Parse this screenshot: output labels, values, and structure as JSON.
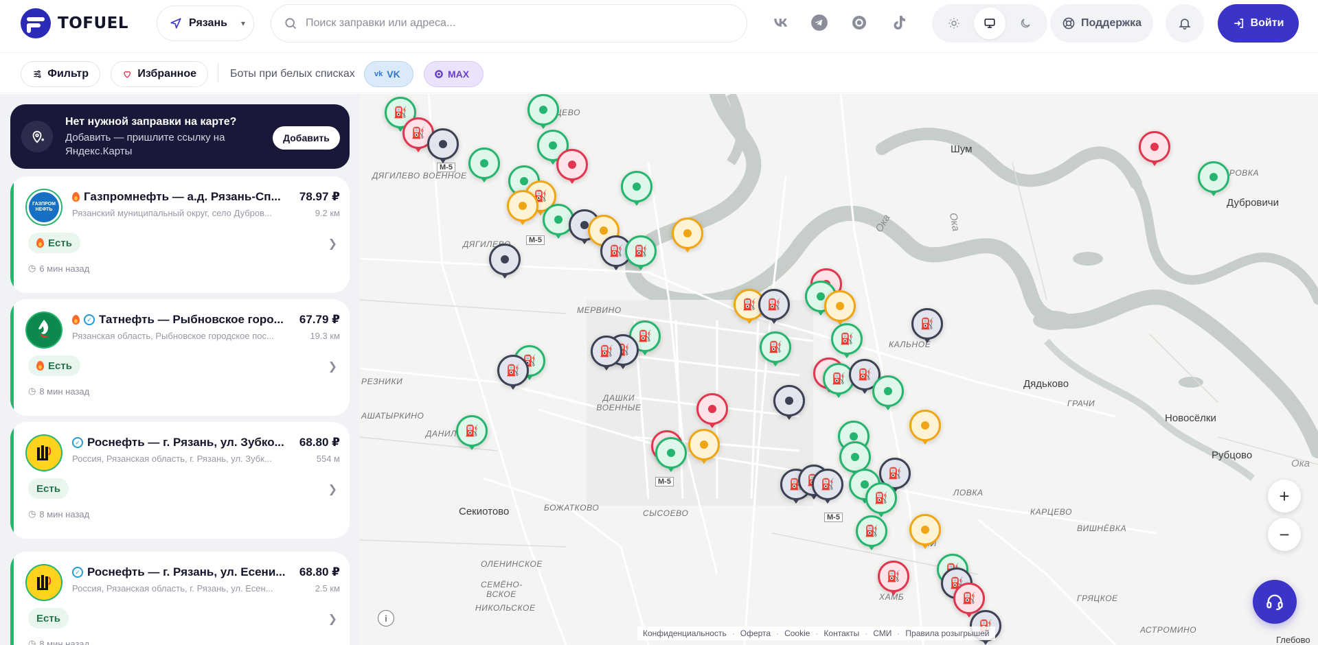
{
  "header": {
    "logo_text": "TOFUEL",
    "city": "Рязань",
    "search_placeholder": "Поиск заправки или адреса...",
    "socials": [
      "vk-icon",
      "telegram-icon",
      "max-icon",
      "tiktok-icon"
    ],
    "theme_options": [
      "light",
      "system",
      "dark"
    ],
    "theme_active": "system",
    "support_label": "Поддержка",
    "login_label": "Войти"
  },
  "filterbar": {
    "filter_label": "Фильтр",
    "favorites_label": "Избранное",
    "bots_label": "Боты при белых списках",
    "bot_vk": "VK",
    "bot_max": "MAX"
  },
  "promo": {
    "title": "Нет нужной заправки на карте?",
    "text": "Добавить — пришлите ссылку на Яндекс.Карты",
    "button": "Добавить"
  },
  "stations": [
    {
      "brand": "gazpromneft",
      "logo_text": "ГАЗПРОМ НЕФТЬ",
      "title": "Газпромнефть — а.д. Рязань-Сп...",
      "price": "78.97 ₽",
      "address": "Рязанский муниципальный округ, село Дубров...",
      "distance": "9.2 км",
      "status": "Есть",
      "time": "6 мин назад",
      "hot": true,
      "verified": false
    },
    {
      "brand": "tatneft",
      "title": "Татнефть — Рыбновское горо...",
      "price": "67.79 ₽",
      "address": "Рязанская область, Рыбновское городское пос...",
      "distance": "19.3 км",
      "status": "Есть",
      "time": "8 мин назад",
      "hot": true,
      "verified": true
    },
    {
      "brand": "rosneft",
      "title": "Роснефть — г. Рязань, ул. Зубко...",
      "price": "68.80 ₽",
      "address": "Россия, Рязанская область, г. Рязань, ул. Зубк...",
      "distance": "554 м",
      "status": "Есть",
      "time": "8 мин назад",
      "hot": false,
      "verified": true
    },
    {
      "brand": "rosneft",
      "title": "Роснефть — г. Рязань, ул. Есени...",
      "price": "68.80 ₽",
      "address": "Россия, Рязанская область, г. Рязань, ул. Есен...",
      "distance": "2.5 км",
      "status": "Есть",
      "time": "8 мин назад",
      "hot": false,
      "verified": true
    }
  ],
  "map": {
    "places": {
      "dyagilevo_voennoe": "ДЯГИЛЕВО ВОЕННОЕ",
      "dyagilevo": "ДЯГИЛЕВО",
      "mervino": "МЕРВИНО",
      "rezniki": "РЕЗНИКИ",
      "shatyrkino": "АШАТЫРКИНО",
      "danilo": "ДАНИЛО",
      "dashki": "ДАШКИ ВОЕННЫЕ",
      "sekiotovo": "Секиотово",
      "bozhatkovo": "БОЖАТКОВО",
      "sysoevo": "СЫСОЕВО",
      "oleninskoe": "ОЛЕНИНСКОЕ",
      "semeno": "СЕМЁНО- ВСКОЕ",
      "nikolskoe": "НИКОЛЬСКОЕ",
      "kalnoe": "КАЛЬНОЕ",
      "dyadkovo": "Дядьково",
      "grachi": "ГРАЧИ",
      "novoselki": "Новосёлки",
      "rubtsovo": "Рубцово",
      "kartsevo": "КАРЦЕВО",
      "vishnevka": "ВИШНЁВКА",
      "gryatskoe": "ГРЯЦКОЕ",
      "astromino": "АСТРОМИНО",
      "hamb": "ХАМБ",
      "dubrovichi": "Дубровичи",
      "dubrovka": "ДУБРОВКА",
      "shum": "Шум",
      "nishchevo": "НИЩЕВО",
      "lovka": "ЛОВКА",
      "mi": "МИ",
      "oka1": "Ока",
      "oka2": "Ока",
      "oka3": "Ока",
      "glebovo": "Глебово",
      "city_partial": "ЗЬ"
    },
    "road_sign": "М-5",
    "zoom_in": "+",
    "zoom_out": "−",
    "info": "i",
    "footer_links": [
      "Конфиденциальность",
      "Оферта",
      "Cookie",
      "Контакты",
      "СМИ",
      "Правила розыгрышей"
    ]
  }
}
